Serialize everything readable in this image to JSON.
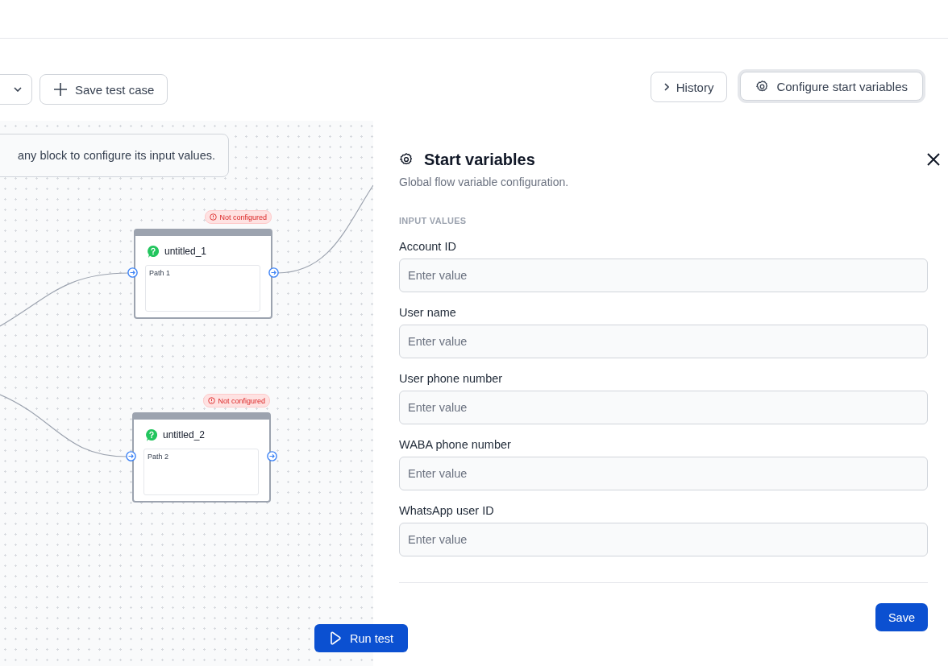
{
  "toolbar": {
    "save_test_case": "Save test case",
    "history": "History",
    "configure": "Configure start variables"
  },
  "canvas": {
    "hint": "any block to configure its input values.",
    "blocks": [
      {
        "title": "untitled_1",
        "status": "Not configured",
        "path": "Path 1"
      },
      {
        "title": "untitled_2",
        "status": "Not configured",
        "path": "Path 2"
      }
    ]
  },
  "panel": {
    "title": "Start variables",
    "subtitle": "Global flow variable configuration.",
    "section": "INPUT VALUES",
    "fields": [
      {
        "label": "Account ID",
        "placeholder": "Enter value"
      },
      {
        "label": "User name",
        "placeholder": "Enter value"
      },
      {
        "label": "User phone number",
        "placeholder": "Enter value"
      },
      {
        "label": "WABA phone number",
        "placeholder": "Enter value"
      },
      {
        "label": "WhatsApp user ID",
        "placeholder": "Enter value"
      }
    ],
    "save": "Save"
  },
  "run_test": "Run test"
}
